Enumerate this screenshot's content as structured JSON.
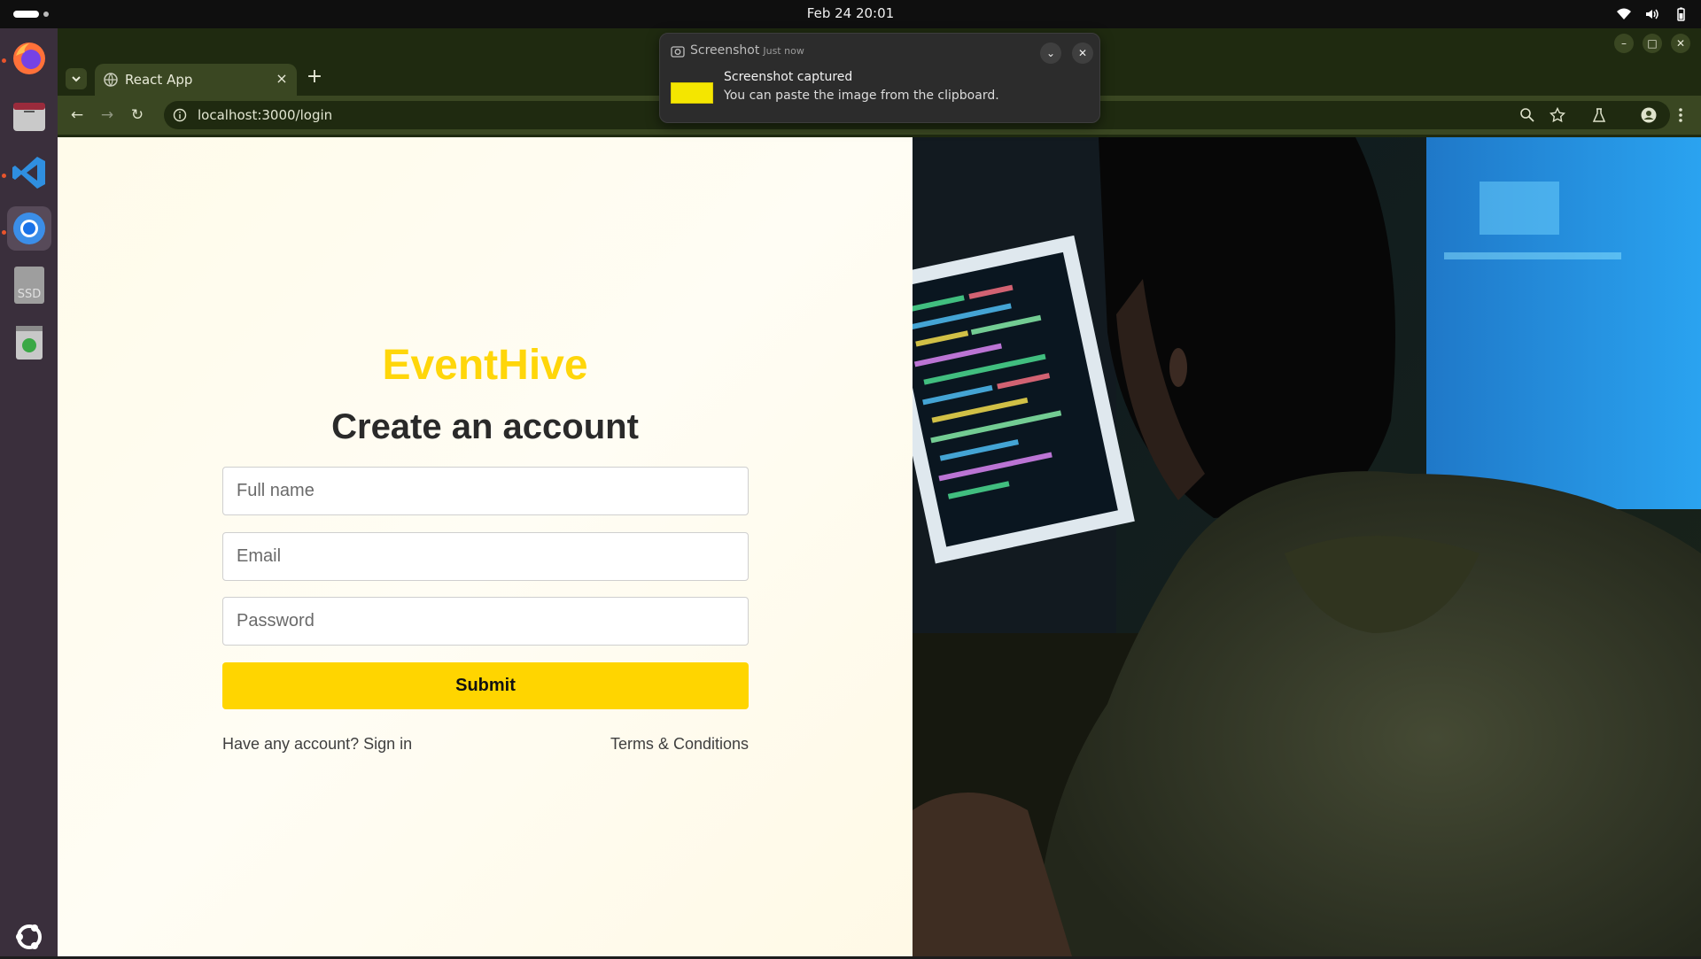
{
  "system": {
    "clock": "Feb 24  20:01"
  },
  "dock": {
    "items": [
      {
        "name": "firefox-icon"
      },
      {
        "name": "files-icon"
      },
      {
        "name": "vscode-icon"
      },
      {
        "name": "chrome-icon"
      },
      {
        "name": "ssd-drive-icon",
        "label": "SSD"
      },
      {
        "name": "trash-icon"
      },
      {
        "name": "ubuntu-apps-icon"
      }
    ]
  },
  "browser": {
    "tab_title": "React App",
    "url": "localhost:3000/login",
    "new_tab_label": "+"
  },
  "notification": {
    "app": "Screenshot",
    "time": "Just now",
    "title": "Screenshot captured",
    "body": "You can paste the image from the clipboard."
  },
  "page": {
    "brand": "EventHive",
    "heading": "Create an account",
    "fields": {
      "full_name_placeholder": "Full name",
      "email_placeholder": "Email",
      "password_placeholder": "Password"
    },
    "submit_label": "Submit",
    "signin_link": "Have any account? Sign in",
    "terms_link": "Terms & Conditions",
    "colors": {
      "brand": "#ffd60a",
      "button": "#ffd500"
    }
  }
}
